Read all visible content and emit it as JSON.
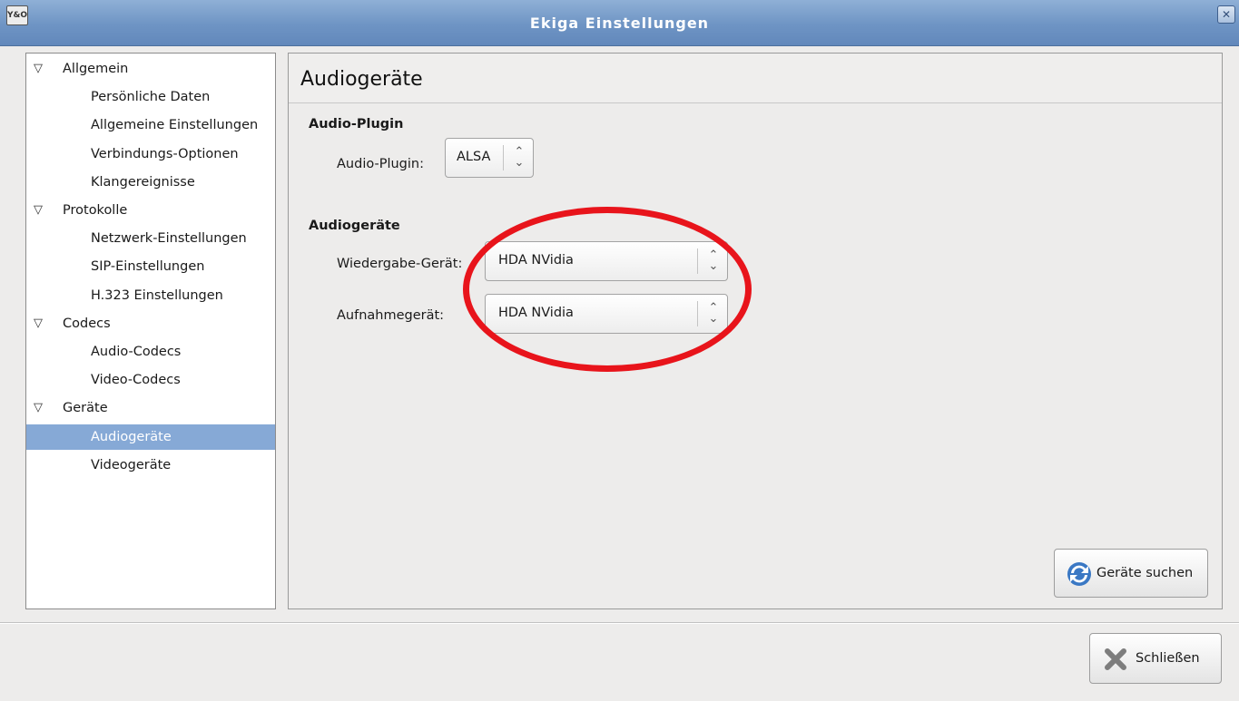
{
  "window": {
    "title": "Ekiga Einstellungen",
    "app_icon_text": "Y&O",
    "close_glyph": "✕"
  },
  "tree": {
    "items": [
      {
        "label": "Allgemein",
        "level": 0
      },
      {
        "label": "Persönliche Daten",
        "level": 1
      },
      {
        "label": "Allgemeine Einstellungen",
        "level": 1
      },
      {
        "label": "Verbindungs-Optionen",
        "level": 1
      },
      {
        "label": "Klangereignisse",
        "level": 1
      },
      {
        "label": "Protokolle",
        "level": 0
      },
      {
        "label": "Netzwerk-Einstellungen",
        "level": 1
      },
      {
        "label": "SIP-Einstellungen",
        "level": 1
      },
      {
        "label": "H.323 Einstellungen",
        "level": 1
      },
      {
        "label": "Codecs",
        "level": 0
      },
      {
        "label": "Audio-Codecs",
        "level": 1
      },
      {
        "label": "Video-Codecs",
        "level": 1
      },
      {
        "label": "Geräte",
        "level": 0
      },
      {
        "label": "Audiogeräte",
        "level": 1,
        "selected": true
      },
      {
        "label": "Videogeräte",
        "level": 1
      }
    ]
  },
  "panel": {
    "title": "Audiogeräte",
    "plugin_section": {
      "title": "Audio-Plugin",
      "label": "Audio-Plugin:",
      "value": "ALSA"
    },
    "devices_section": {
      "title": "Audiogeräte",
      "playback_label": "Wiedergabe-Gerät:",
      "playback_value": "HDA NVidia",
      "record_label": "Aufnahmegerät:",
      "record_value": "HDA NVidia"
    },
    "search_button": "Geräte suchen"
  },
  "footer": {
    "close_button": "Schließen"
  },
  "colors": {
    "annotation": "#e8141b",
    "selection": "#86a9d6",
    "titlebar": "#6e94c4"
  }
}
